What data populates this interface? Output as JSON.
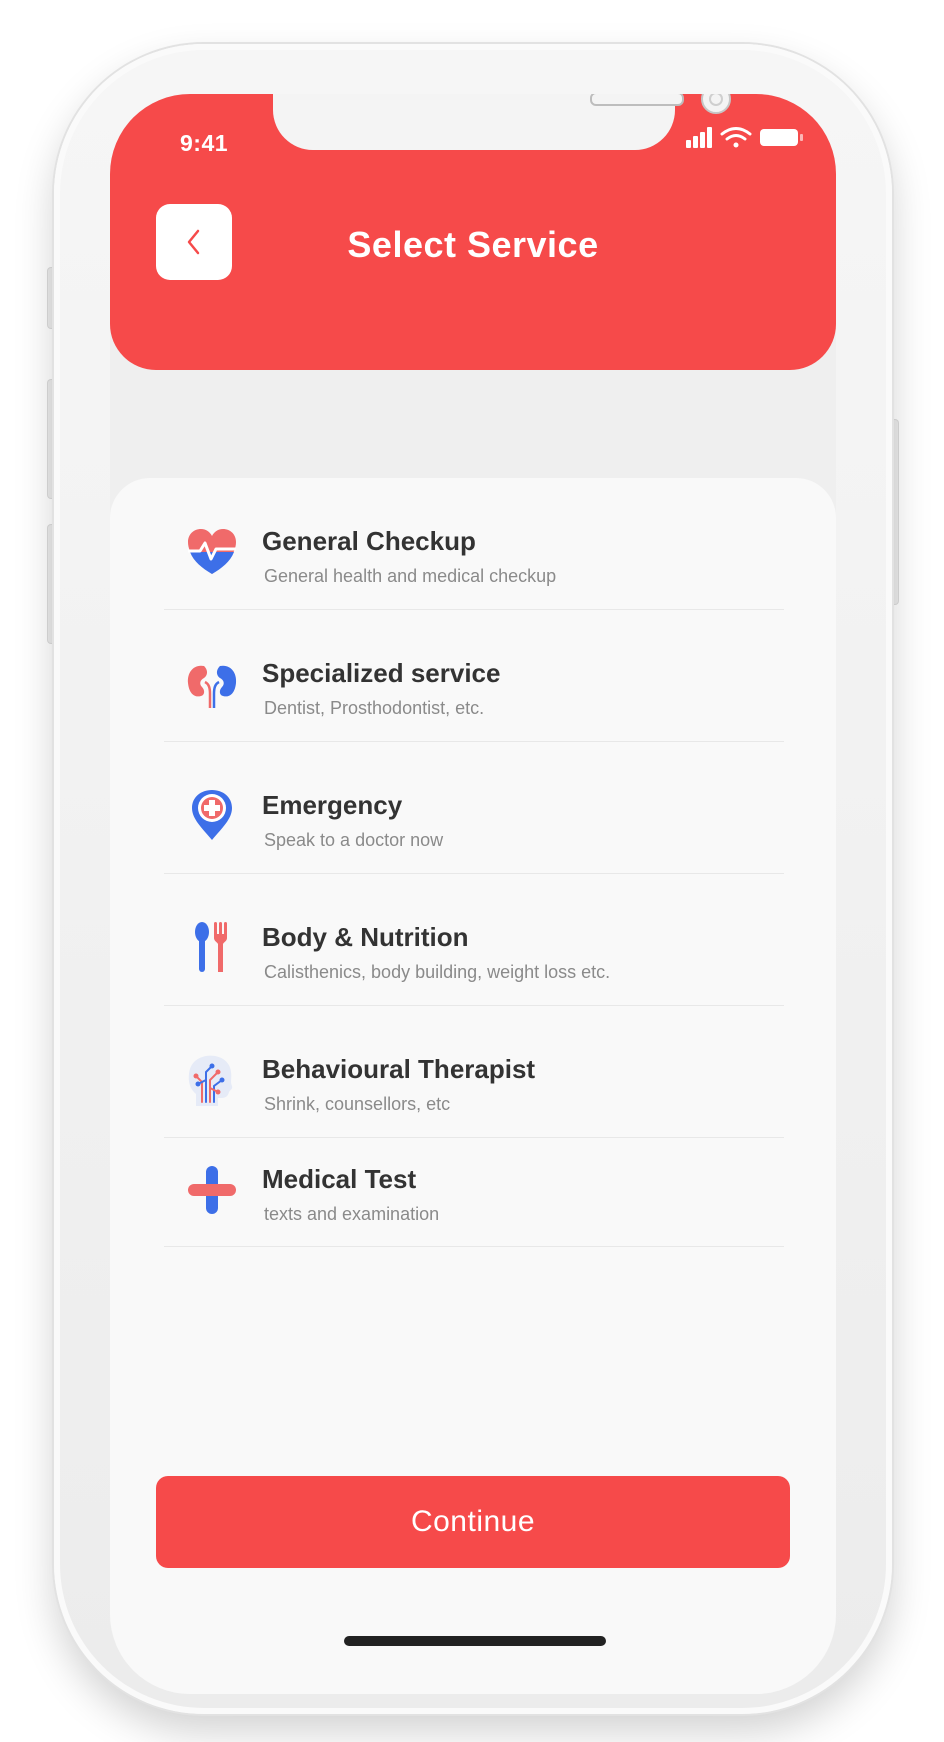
{
  "status_bar": {
    "time": "9:41",
    "signal_icon": "signal-bars-icon",
    "wifi_icon": "wifi-icon",
    "battery_icon": "battery-icon"
  },
  "header": {
    "title": "Select Service",
    "back_icon": "chevron-left-icon"
  },
  "services": [
    {
      "name": "General Checkup",
      "description": "General health and medical checkup",
      "icon": "heart-pulse-icon"
    },
    {
      "name": "Specialized service",
      "description": "Dentist, Prosthodontist, etc.",
      "icon": "kidneys-icon"
    },
    {
      "name": "Emergency",
      "description": "Speak to a doctor now",
      "icon": "emergency-pin-icon"
    },
    {
      "name": "Body & Nutrition",
      "description": "Calisthenics, body building, weight loss etc.",
      "icon": "spoon-fork-icon"
    },
    {
      "name": "Behavioural Therapist",
      "description": "Shrink, counsellors, etc",
      "icon": "brain-circuit-icon"
    },
    {
      "name": "Medical Test",
      "description": "texts and examination",
      "icon": "medical-cross-icon"
    }
  ],
  "footer": {
    "continue_label": "Continue"
  },
  "colors": {
    "accent": "#f64a4a",
    "accent_blue": "#3d6fe8",
    "text_dark": "#333333",
    "text_muted": "#8a8a8a"
  }
}
